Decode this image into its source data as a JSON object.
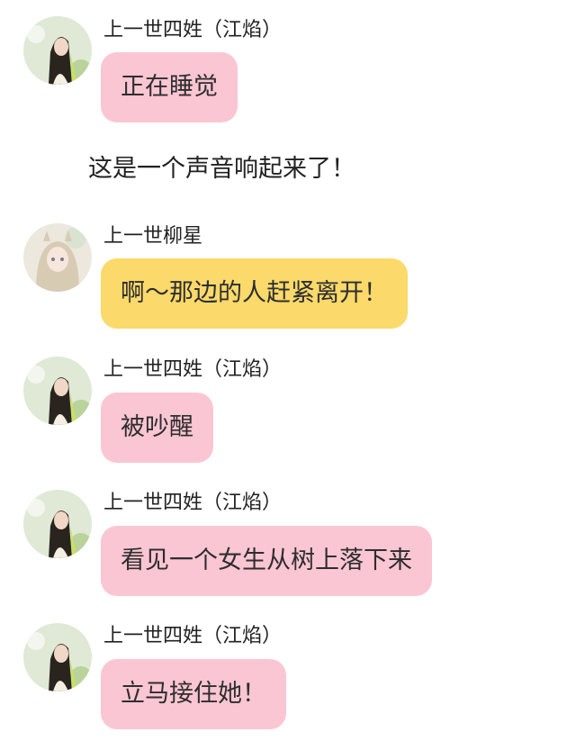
{
  "messages": [
    {
      "type": "chat",
      "speaker": "上一世四姓（江焰）",
      "avatar": "male-long-hair-avatar",
      "text": "正在睡觉",
      "color": "#fbc6d3"
    },
    {
      "type": "narration",
      "text": "这是一个声音响起来了！"
    },
    {
      "type": "chat",
      "speaker": "上一世柳星",
      "avatar": "female-light-hair-avatar",
      "text": "啊～那边的人赶紧离开！",
      "color": "#fbd96b"
    },
    {
      "type": "chat",
      "speaker": "上一世四姓（江焰）",
      "avatar": "male-long-hair-avatar",
      "text": "被吵醒",
      "color": "#fbc6d3"
    },
    {
      "type": "chat",
      "speaker": "上一世四姓（江焰）",
      "avatar": "male-long-hair-avatar",
      "text": "看见一个女生从树上落下来",
      "color": "#fbc6d3"
    },
    {
      "type": "chat",
      "speaker": "上一世四姓（江焰）",
      "avatar": "male-long-hair-avatar",
      "text": "立马接住她！",
      "color": "#fbc6d3"
    }
  ]
}
